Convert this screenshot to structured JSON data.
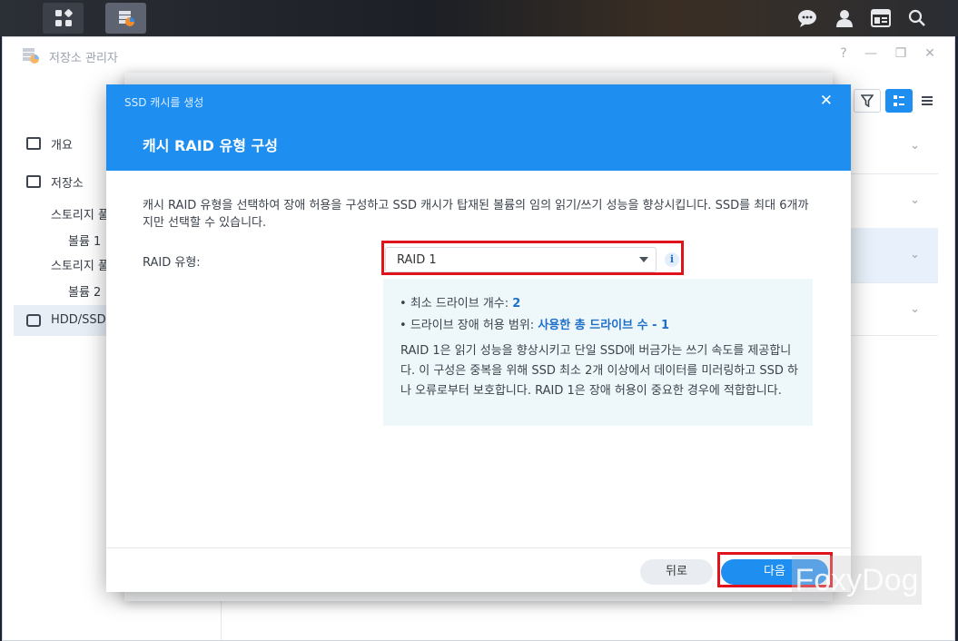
{
  "window": {
    "title": "저장소 관리자",
    "controls": [
      "?",
      "—",
      "❐",
      "✕"
    ]
  },
  "sidebar": {
    "items": [
      {
        "label": "개요",
        "icon": "overview-icon"
      },
      {
        "label": "저장소",
        "icon": "storage-icon"
      },
      {
        "label": "스토리지 풀"
      },
      {
        "label": "볼륨 1"
      },
      {
        "label": "스토리지 풀"
      },
      {
        "label": "볼륨 2"
      },
      {
        "label": "HDD/SSD",
        "icon": "hdd-icon"
      }
    ]
  },
  "dialog": {
    "caption": "SSD 캐시를 생성",
    "title": "캐시 RAID 유형 구성",
    "description": "캐시 RAID 유형을 선택하여 장애 허용을 구성하고 SSD 캐시가 탑재된 볼륨의 임의 읽기/쓰기 성능을 향상시킵니다. SSD를 최대 6개까지만 선택할 수 있습니다.",
    "raid_label": "RAID 유형:",
    "raid_value": "RAID 1",
    "info": {
      "min_drives_label": "최소 드라이브 개수:",
      "min_drives_value": "2",
      "tolerance_label": "드라이브 장애 허용 범위:",
      "tolerance_value": "사용한 총 드라이브 수 - 1",
      "paragraph": "RAID 1은 읽기 성능을 향상시키고 단일 SSD에 버금가는 쓰기 속도를 제공합니다. 이 구성은 중복을 위해 SSD 최소 2개 이상에서 데이터를 미러링하고 SSD 하나 오류로부터 보호합니다. RAID 1은 장애 허용이 중요한 경우에 적합합니다."
    },
    "back_label": "뒤로",
    "next_label": "다음"
  },
  "watermark": "FoxyDog",
  "colors": {
    "accent": "#1f8ef1",
    "highlight": "#e0121b",
    "info_bg": "#eef8fb"
  }
}
